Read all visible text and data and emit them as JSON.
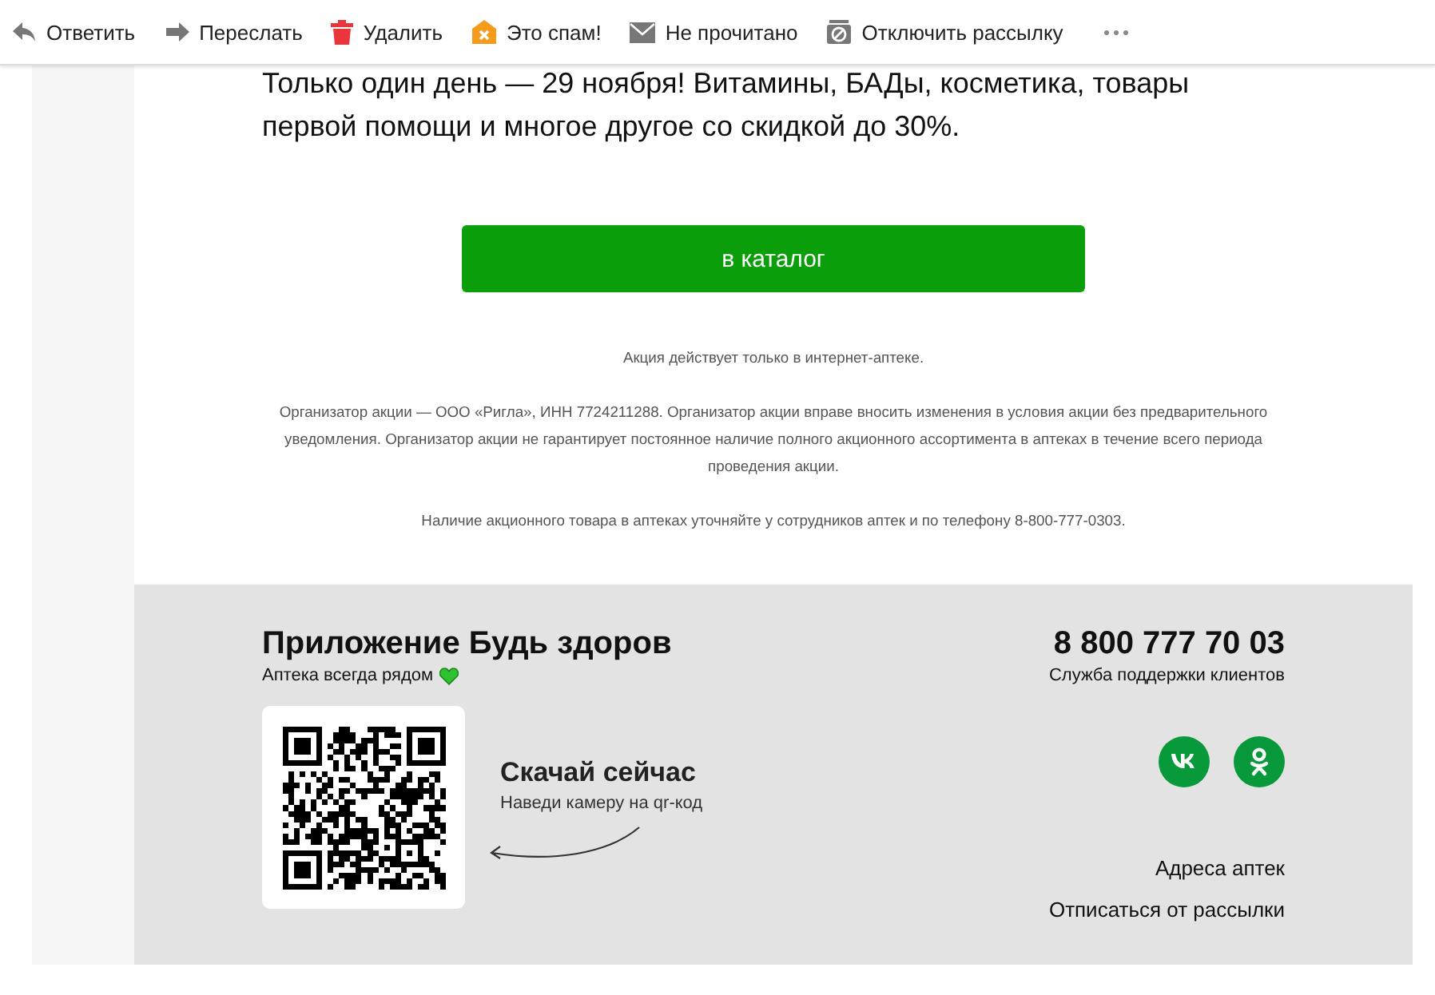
{
  "toolbar": [
    {
      "label": "Ответить"
    },
    {
      "label": "Переслать"
    },
    {
      "label": "Удалить"
    },
    {
      "label": "Это спам!"
    },
    {
      "label": "Не прочитано"
    },
    {
      "label": "Отключить рассылку"
    }
  ],
  "intro": "Только один день — 29 ноября! Витамины, БАДы, косметика, товары первой помощи и многое другое со скидкой до 30%.",
  "cta_button": "в каталог",
  "notes": [
    "Акция действует только в интернет-аптеке.",
    "Организатор акции — ООО «Ригла», ИНН 7724211288. Организатор акции вправе вносить изменения в условия акции без предварительного уведомления. Организатор акции не гарантирует постоянное наличие полного акционного ассортимента в аптеках в течение всего периода проведения акции.",
    "Наличие акционного товара в аптеках уточняйте у сотрудников аптек и по телефону 8-800-777-0303."
  ],
  "footer": {
    "app_title": "Приложение Будь здоров",
    "app_subtitle": "Аптека всегда рядом",
    "download_title": "Скачай сейчас",
    "download_hint": "Наведи камеру на qr-код",
    "phone": "8 800 777 70 03",
    "phone_caption": "Служба поддержки клиентов",
    "links": [
      "Адреса аптек",
      "Отписаться от рассылки"
    ]
  }
}
